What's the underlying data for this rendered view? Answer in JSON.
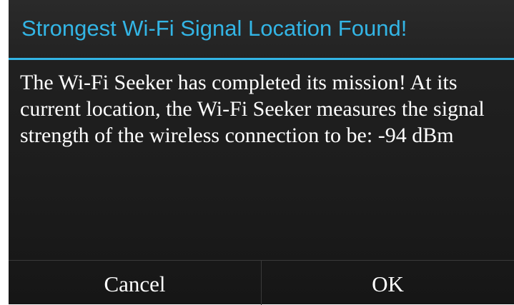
{
  "dialog": {
    "title": "Strongest Wi-Fi Signal Location Found!",
    "message": "The Wi-Fi Seeker has completed its mission! At its current location, the Wi-Fi Seeker measures the signal strength of the wireless connection to be:  -94 dBm",
    "buttons": {
      "cancel_label": "Cancel",
      "ok_label": "OK"
    }
  },
  "colors": {
    "accent": "#33b5e5",
    "background": "#1e1e1e",
    "text": "#ffffff"
  }
}
